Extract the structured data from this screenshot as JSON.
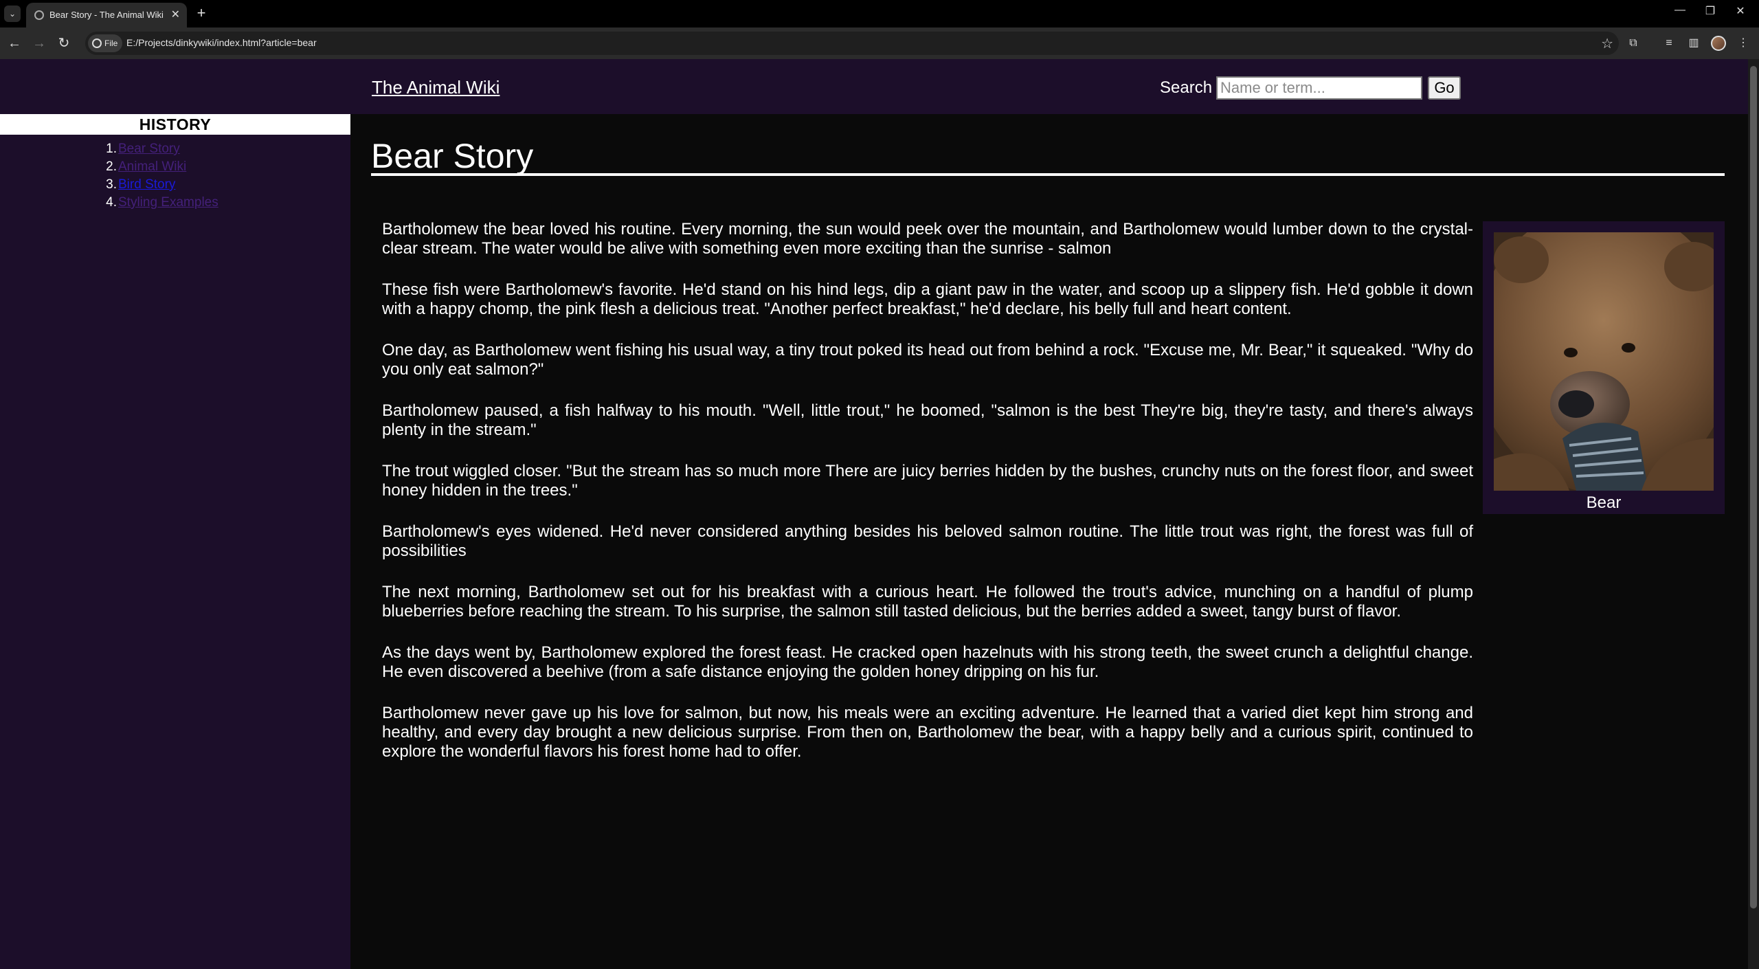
{
  "browser": {
    "tab_title": "Bear Story - The Animal Wiki",
    "url_chip": "File",
    "url": "E:/Projects/dinkywiki/index.html?article=bear"
  },
  "header": {
    "site_title": "The Animal Wiki",
    "search_label": "Search",
    "search_placeholder": "Name or term...",
    "go_label": "Go"
  },
  "sidebar": {
    "heading": "HISTORY",
    "items": [
      {
        "num": "1.",
        "label": "Bear Story"
      },
      {
        "num": "2.",
        "label": "Animal Wiki"
      },
      {
        "num": "3.",
        "label": "Bird Story"
      },
      {
        "num": "4.",
        "label": "Styling Examples"
      }
    ]
  },
  "article": {
    "title": "Bear Story",
    "figure_caption": "Bear",
    "paragraphs": [
      "Bartholomew the bear loved his routine. Every morning, the sun would peek over the mountain, and Bartholomew would lumber down to the crystal-clear stream. The water would be alive with something even more exciting than the sunrise - salmon",
      "These fish were Bartholomew's favorite. He'd stand on his hind legs, dip a giant paw in the water, and scoop up a slippery fish. He'd gobble it down with a happy chomp, the pink flesh a delicious treat. \"Another perfect breakfast,\" he'd declare, his belly full and heart content.",
      "One day, as Bartholomew went fishing his usual way, a tiny trout poked its head out from behind a rock. \"Excuse me, Mr. Bear,\" it squeaked. \"Why do you only eat salmon?\"",
      "Bartholomew paused, a fish halfway to his mouth. \"Well, little trout,\" he boomed, \"salmon is the best They're big, they're tasty, and there's always plenty in the stream.\"",
      "The trout wiggled closer. \"But the stream has so much more There are juicy berries hidden by the bushes, crunchy nuts on the forest floor, and sweet honey hidden in the trees.\"",
      "Bartholomew's eyes widened. He'd never considered anything besides his beloved salmon routine. The little trout was right, the forest was full of possibilities",
      "The next morning, Bartholomew set out for his breakfast with a curious heart. He followed the trout's advice, munching on a handful of plump blueberries before reaching the stream. To his surprise, the salmon still tasted delicious, but the berries added a sweet, tangy burst of flavor.",
      "As the days went by, Bartholomew explored the forest feast. He cracked open hazelnuts with his strong teeth, the sweet crunch a delightful change. He even discovered a beehive (from a safe distance enjoying the golden honey dripping on his fur.",
      "Bartholomew never gave up his love for salmon, but now, his meals were an exciting adventure. He learned that a varied diet kept him strong and healthy, and every day brought a new delicious surprise. From then on, Bartholomew the bear, with a happy belly and a curious spirit, continued to explore the wonderful flavors his forest home had to offer."
    ]
  }
}
